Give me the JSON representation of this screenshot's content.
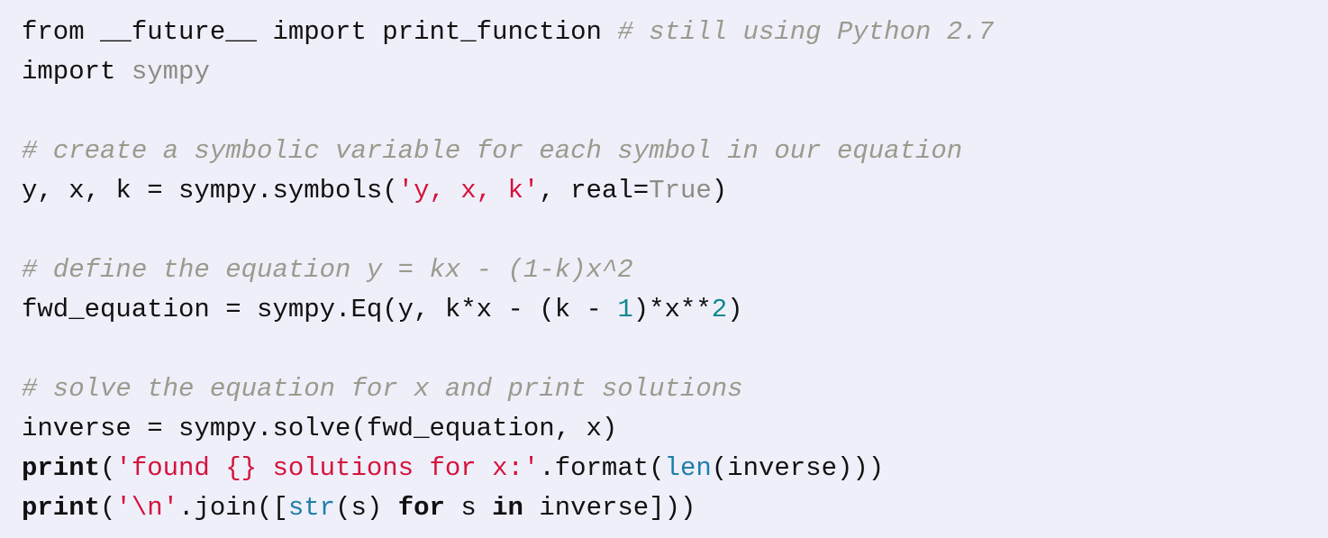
{
  "code_block": {
    "colors": {
      "background": "#efeffa",
      "text": "#111111",
      "comment": "#9a9a8e",
      "string": "#d4143c",
      "number": "#0f8b8d",
      "builtin": "#1f7fa9",
      "muted": "#8c8c84"
    },
    "lines": [
      {
        "tokens": [
          {
            "type": "plain",
            "text": "from __future__ import print_function "
          },
          {
            "type": "comment",
            "text": "# still using Python 2.7"
          }
        ]
      },
      {
        "tokens": [
          {
            "type": "plain",
            "text": "import "
          },
          {
            "type": "muted",
            "text": "sympy"
          }
        ]
      },
      {
        "tokens": []
      },
      {
        "tokens": [
          {
            "type": "comment",
            "text": "# create a symbolic variable for each symbol in our equation"
          }
        ]
      },
      {
        "tokens": [
          {
            "type": "plain",
            "text": "y, x, k = sympy.symbols("
          },
          {
            "type": "string",
            "text": "'y, x, k'"
          },
          {
            "type": "plain",
            "text": ", real="
          },
          {
            "type": "muted",
            "text": "True"
          },
          {
            "type": "plain",
            "text": ")"
          }
        ]
      },
      {
        "tokens": []
      },
      {
        "tokens": [
          {
            "type": "comment",
            "text": "# define the equation y = kx - (1-k)x^2"
          }
        ]
      },
      {
        "tokens": [
          {
            "type": "plain",
            "text": "fwd_equation = sympy.Eq(y, k*x - (k - "
          },
          {
            "type": "number",
            "text": "1"
          },
          {
            "type": "plain",
            "text": ")*x**"
          },
          {
            "type": "number",
            "text": "2"
          },
          {
            "type": "plain",
            "text": ")"
          }
        ]
      },
      {
        "tokens": []
      },
      {
        "tokens": [
          {
            "type": "comment",
            "text": "# solve the equation for x and print solutions"
          }
        ]
      },
      {
        "tokens": [
          {
            "type": "plain",
            "text": "inverse = sympy.solve(fwd_equation, x)"
          }
        ]
      },
      {
        "tokens": [
          {
            "type": "keyword",
            "text": "print"
          },
          {
            "type": "plain",
            "text": "("
          },
          {
            "type": "string",
            "text": "'found {} solutions for x:'"
          },
          {
            "type": "plain",
            "text": ".format("
          },
          {
            "type": "builtin",
            "text": "len"
          },
          {
            "type": "plain",
            "text": "(inverse)))"
          }
        ]
      },
      {
        "tokens": [
          {
            "type": "keyword",
            "text": "print"
          },
          {
            "type": "plain",
            "text": "("
          },
          {
            "type": "string",
            "text": "'\\n'"
          },
          {
            "type": "plain",
            "text": ".join(["
          },
          {
            "type": "builtin",
            "text": "str"
          },
          {
            "type": "plain",
            "text": "(s) "
          },
          {
            "type": "keyword",
            "text": "for"
          },
          {
            "type": "plain",
            "text": " s "
          },
          {
            "type": "keyword",
            "text": "in"
          },
          {
            "type": "plain",
            "text": " inverse]))"
          }
        ]
      }
    ]
  }
}
